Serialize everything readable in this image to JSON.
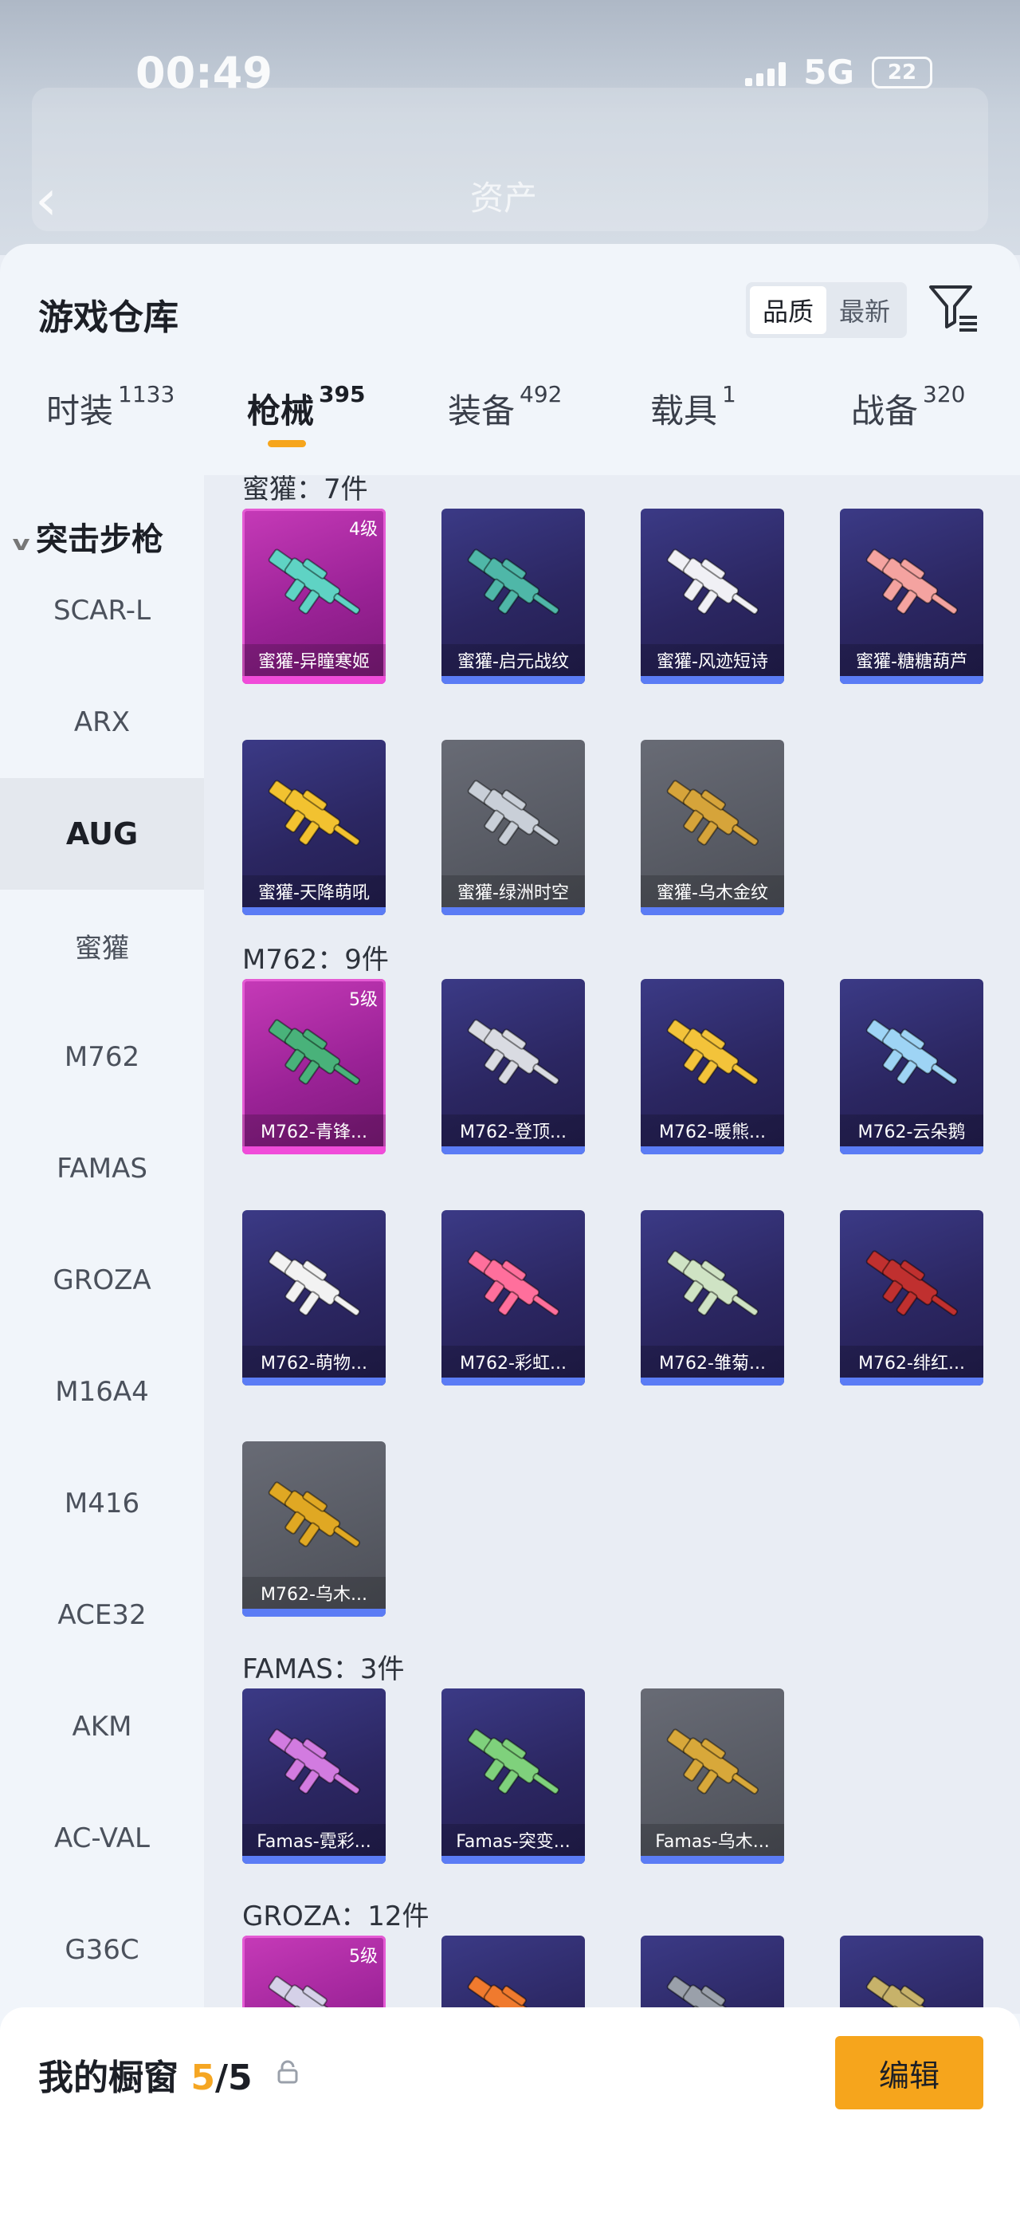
{
  "status_bar": {
    "time": "00:49",
    "network": "5G",
    "battery": "22"
  },
  "background_title": "资产",
  "warehouse": {
    "title": "游戏仓库",
    "sort_options": [
      {
        "label": "品质",
        "selected": true
      },
      {
        "label": "最新",
        "selected": false
      }
    ]
  },
  "tabs": [
    {
      "label": "时装",
      "count": "1133"
    },
    {
      "label": "枪械",
      "count": "395",
      "selected": true
    },
    {
      "label": "装备",
      "count": "492"
    },
    {
      "label": "载具",
      "count": "1"
    },
    {
      "label": "战备",
      "count": "320"
    }
  ],
  "sidebar": {
    "group": "突击步枪",
    "items": [
      "SCAR-L",
      "ARX",
      "AUG",
      "蜜獾",
      "M762",
      "FAMAS",
      "GROZA",
      "M16A4",
      "M416",
      "ACE32",
      "AKM",
      "AC-VAL",
      "G36C"
    ],
    "selected": "AUG"
  },
  "groups": [
    {
      "title": "蜜獾：7件",
      "items": [
        {
          "name": "蜜獾-异瞳寒姬",
          "rarity": "pink",
          "level": "4级"
        },
        {
          "name": "蜜獾-启元战纹",
          "rarity": "purple"
        },
        {
          "name": "蜜獾-风迹短诗",
          "rarity": "purple"
        },
        {
          "name": "蜜獾-糖糖葫芦",
          "rarity": "purple"
        },
        {
          "name": "蜜獾-天降萌吼",
          "rarity": "purple"
        },
        {
          "name": "蜜獾-绿洲时空",
          "rarity": "grey"
        },
        {
          "name": "蜜獾-乌木金纹",
          "rarity": "grey"
        }
      ]
    },
    {
      "title": "M762：9件",
      "items": [
        {
          "name": "M762-青锋...",
          "rarity": "pink",
          "level": "5级"
        },
        {
          "name": "M762-登顶...",
          "rarity": "purple"
        },
        {
          "name": "M762-暖熊...",
          "rarity": "purple"
        },
        {
          "name": "M762-云朵鹅",
          "rarity": "purple"
        },
        {
          "name": "M762-萌物...",
          "rarity": "purple"
        },
        {
          "name": "M762-彩虹...",
          "rarity": "purple"
        },
        {
          "name": "M762-雏菊...",
          "rarity": "purple"
        },
        {
          "name": "M762-绯红...",
          "rarity": "purple"
        },
        {
          "name": "M762-乌木...",
          "rarity": "grey"
        }
      ]
    },
    {
      "title": "FAMAS：3件",
      "items": [
        {
          "name": "Famas-霓彩...",
          "rarity": "purple"
        },
        {
          "name": "Famas-突变...",
          "rarity": "purple"
        },
        {
          "name": "Famas-乌木...",
          "rarity": "grey"
        }
      ]
    },
    {
      "title": "GROZA：12件",
      "items": [
        {
          "name": "",
          "rarity": "pink",
          "level": "5级"
        },
        {
          "name": "",
          "rarity": "purple"
        },
        {
          "name": "",
          "rarity": "purple"
        },
        {
          "name": "",
          "rarity": "purple"
        }
      ]
    }
  ],
  "gun_colors": [
    "#5fd3c4",
    "#4fb7a8",
    "#f0f0f5",
    "#f4a3a0",
    "#f2c230",
    "#c9cfd8",
    "#d6a43a",
    "#49b27a",
    "#d9dbe2",
    "#f3c33a",
    "#9ed4f5",
    "#f2f2f2",
    "#ff6f9c",
    "#cfe3c4",
    "#c0302f",
    "#e0a823",
    "#d27be0",
    "#7fd17c",
    "#d8a83a",
    "#d5d1e8",
    "#f07a2e",
    "#9aa0aa",
    "#c7b26a"
  ],
  "showcase": {
    "title": "我的橱窗",
    "current": "5",
    "total": "/5",
    "edit_label": "编辑"
  }
}
